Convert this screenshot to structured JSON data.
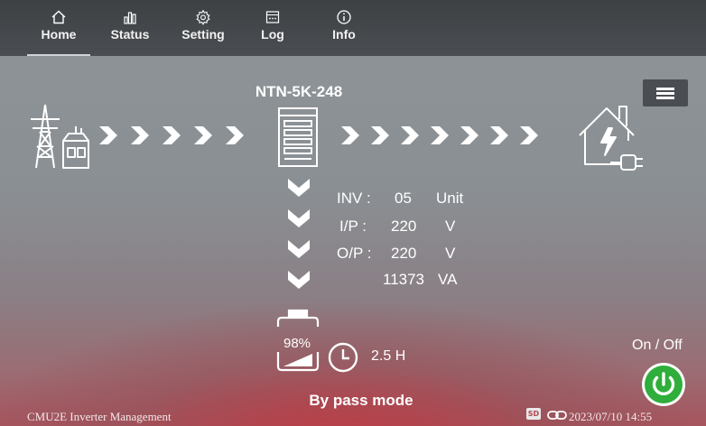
{
  "nav": {
    "items": [
      {
        "label": "Home",
        "icon": "home-icon"
      },
      {
        "label": "Status",
        "icon": "bar-chart-icon"
      },
      {
        "label": "Setting",
        "icon": "gear-icon"
      },
      {
        "label": "Log",
        "icon": "log-icon"
      },
      {
        "label": "Info",
        "icon": "info-icon"
      }
    ],
    "active": "Home"
  },
  "device": {
    "model": "NTN-5K-248"
  },
  "readings": {
    "inv_label": "INV :",
    "inv_value": "05",
    "inv_unit": "Unit",
    "ip_label": "I/P :",
    "ip_value": "220",
    "ip_unit": "V",
    "op_label": "O/P :",
    "op_value": "220",
    "op_unit": "V",
    "power_value": "11373",
    "power_unit": "VA"
  },
  "battery": {
    "percent_text": "98%",
    "level": 0.98,
    "runtime": "2.5 H"
  },
  "mode": "By pass mode",
  "power": {
    "label": "On / Off",
    "color": "#2fae3c"
  },
  "footer": {
    "app_name": "CMU2E Inverter Management",
    "sd_label": "SD",
    "datetime": "2023/07/10 14:55"
  },
  "colors": {
    "topbar": "#3f4346",
    "menu_button": "#4a4e52",
    "accent_red": "#c63a44"
  }
}
